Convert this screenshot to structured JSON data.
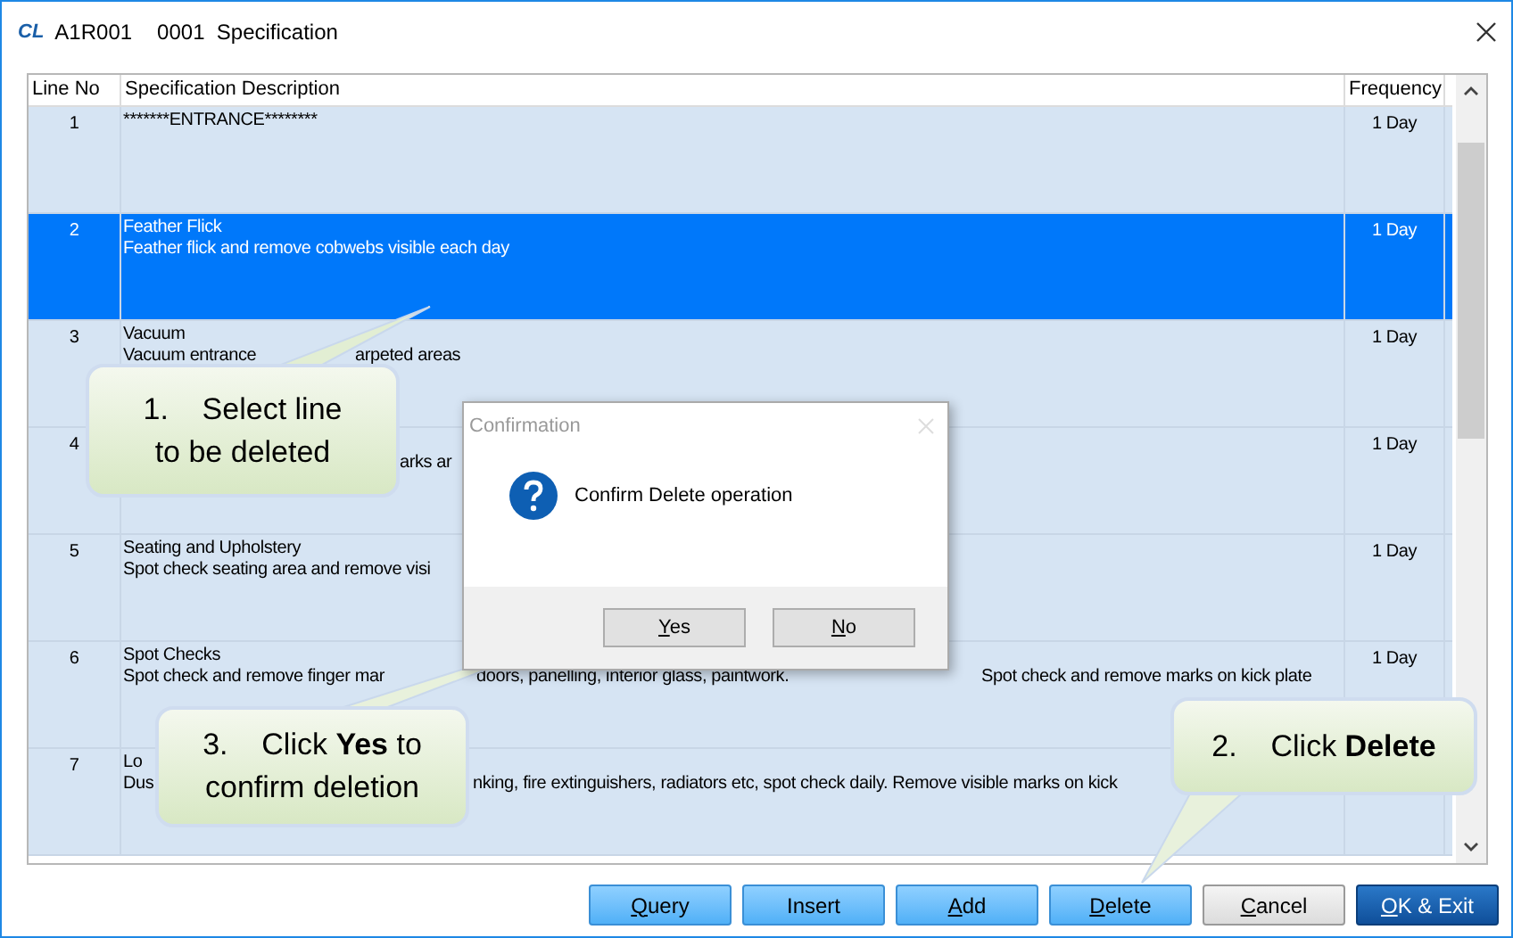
{
  "window": {
    "logo_text": "CL",
    "title_code": "A1R001",
    "title": "0001  Specification"
  },
  "table": {
    "columns": [
      "Line No",
      "Specification Description",
      "Frequency"
    ],
    "rows": [
      {
        "line_no": "1",
        "selected": false,
        "lines": [
          [
            "*******ENTRANCE********"
          ]
        ],
        "frequency": "1 Day"
      },
      {
        "line_no": "2",
        "selected": true,
        "lines": [
          [
            "Feather Flick"
          ],
          [
            "Feather flick and remove cobwebs visible each day"
          ]
        ],
        "frequency": "1 Day"
      },
      {
        "line_no": "3",
        "selected": false,
        "lines": [
          [
            "Vacuum"
          ],
          [
            "Vacuum entrance",
            "arpeted areas"
          ]
        ],
        "frequency": "1 Day"
      },
      {
        "line_no": "4",
        "selected": false,
        "lines": [
          [
            "arks ar"
          ]
        ],
        "frequency": "1 Day"
      },
      {
        "line_no": "5",
        "selected": false,
        "lines": [
          [
            "Seating and Upholstery"
          ],
          [
            "Spot check seating area and remove visi"
          ]
        ],
        "frequency": "1 Day"
      },
      {
        "line_no": "6",
        "selected": false,
        "lines": [
          [
            "Spot Checks"
          ],
          [
            "Spot check and remove finger mar",
            "doors, panelling, interior glass, paintwork.",
            "Spot check and remove marks on kick plate"
          ]
        ],
        "frequency": "1 Day"
      },
      {
        "line_no": "7",
        "selected": false,
        "lines": [
          [
            "Lo"
          ],
          [
            "Dus",
            "nking, fire extinguishers, radiators etc, spot check daily. Remove visible marks on kick"
          ]
        ]
      }
    ]
  },
  "buttons": [
    {
      "label": "Query",
      "kind": "action",
      "underline_first": true
    },
    {
      "label": "Insert",
      "kind": "action",
      "underline_first": false
    },
    {
      "label": "Add",
      "kind": "action",
      "underline_first": true
    },
    {
      "label": "Delete",
      "kind": "action",
      "underline_first": true
    },
    {
      "label": "Cancel",
      "kind": "neutral",
      "underline_first": true
    },
    {
      "label": "OK & Exit",
      "kind": "primary",
      "underline_first": true
    }
  ],
  "dialog": {
    "title": "Confirmation",
    "message": "Confirm Delete operation",
    "buttons": [
      {
        "label": "Yes",
        "underline_first": true
      },
      {
        "label": "No",
        "underline_first": true
      }
    ]
  },
  "callouts": [
    {
      "lines": [
        "1.    Select line",
        "to be deleted"
      ]
    },
    {
      "lines": [
        "2.    Click **Delete**"
      ]
    },
    {
      "lines": [
        "3.    Click **Yes** to",
        "confirm deletion"
      ]
    }
  ]
}
